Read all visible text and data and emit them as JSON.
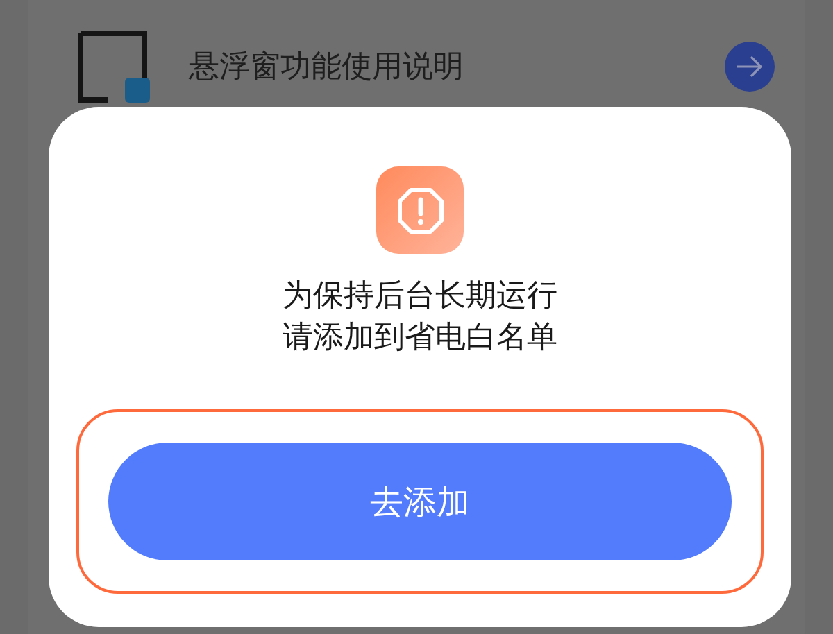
{
  "background_list": {
    "items": [
      {
        "title": "悬浮窗功能使用说明"
      }
    ]
  },
  "dialog": {
    "message_lines": [
      "为保持后台长期运行",
      "请添加到省电白名单"
    ],
    "button": {
      "label": "去添加",
      "highlighted": true
    }
  }
}
